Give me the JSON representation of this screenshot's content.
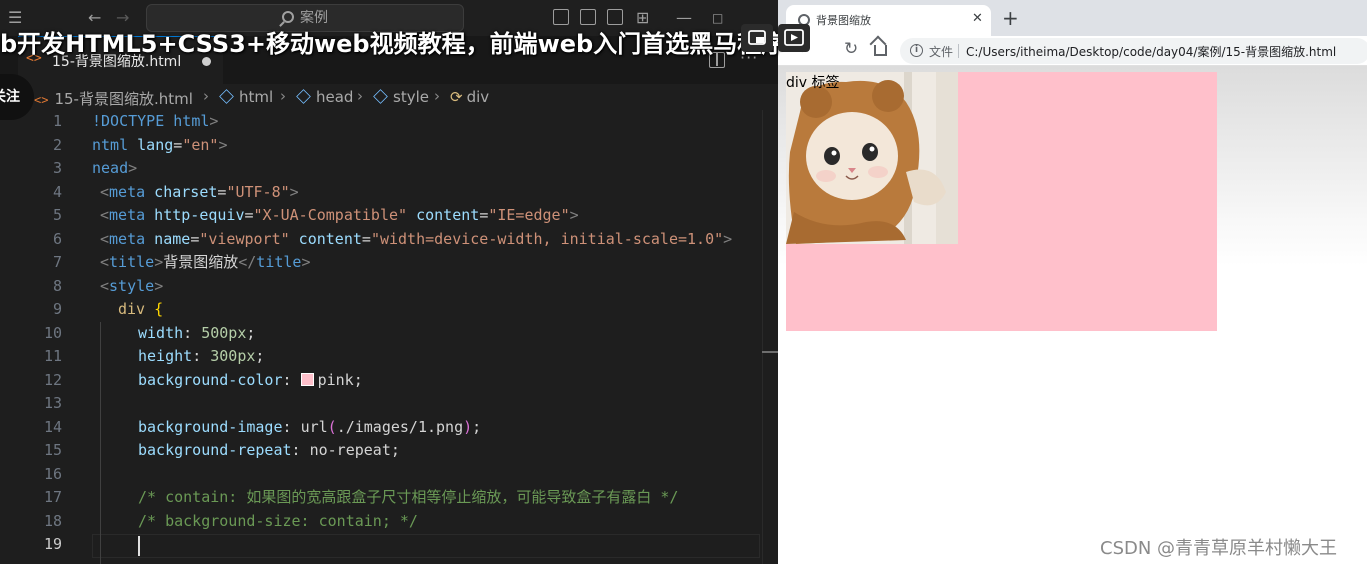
{
  "overlay": {
    "video_title": "b开发HTML5+CSS3+移动web视频教程，前端web入门首选黑马程序",
    "follow_label": "关注"
  },
  "vscode": {
    "search_placeholder": "案例",
    "tab": {
      "label": "15-背景图缩放.html",
      "icon_text": "<>"
    },
    "breadcrumb": [
      {
        "label": "15-背景图缩放.html"
      },
      {
        "label": "html"
      },
      {
        "label": "head"
      },
      {
        "label": "style"
      },
      {
        "label": "div"
      }
    ],
    "active_line": 19,
    "line_numbers": [
      "1",
      "2",
      "3",
      "4",
      "5",
      "6",
      "7",
      "8",
      "9",
      "10",
      "11",
      "12",
      "13",
      "14",
      "15",
      "16",
      "17",
      "18",
      "19"
    ],
    "code": {
      "l1_a": "!DOCTYPE",
      "l1_b": " html",
      "l1_c": ">",
      "l2_a": "ntml",
      "l2_b": " lang",
      "l2_c": "=",
      "l2_d": "\"en\"",
      "l2_e": ">",
      "l3_a": "nead",
      "l3_b": ">",
      "l4_a": "<",
      "l4_b": "meta",
      "l4_c": " charset",
      "l4_d": "=",
      "l4_e": "\"UTF-8\"",
      "l4_f": ">",
      "l5_a": "<",
      "l5_b": "meta",
      "l5_c": " http-equiv",
      "l5_d": "=",
      "l5_e": "\"X-UA-Compatible\"",
      "l5_f": " content",
      "l5_g": "=",
      "l5_h": "\"IE=edge\"",
      "l5_i": ">",
      "l6_a": "<",
      "l6_b": "meta",
      "l6_c": " name",
      "l6_d": "=",
      "l6_e": "\"viewport\"",
      "l6_f": " content",
      "l6_g": "=",
      "l6_h": "\"width=device-width, initial-scale=1.0\"",
      "l6_i": ">",
      "l7_a": "<",
      "l7_b": "title",
      "l7_c": ">",
      "l7_d": "背景图缩放",
      "l7_e": "</",
      "l7_f": "title",
      "l7_g": ">",
      "l8_a": "<",
      "l8_b": "style",
      "l8_c": ">",
      "l9_a": "div",
      "l9_b": " {",
      "l10_a": "width",
      "l10_b": ": ",
      "l10_c": "500px",
      "l10_d": ";",
      "l11_a": "height",
      "l11_b": ": ",
      "l11_c": "300px",
      "l11_d": ";",
      "l12_a": "background-color",
      "l12_b": ": ",
      "l12_c": "pink",
      "l12_d": ";",
      "l14_a": "background-image",
      "l14_b": ": ",
      "l14_c": "url",
      "l14_d": "(",
      "l14_e": "./images/1.png",
      "l14_f": ")",
      "l14_g": ";",
      "l15_a": "background-repeat",
      "l15_b": ": ",
      "l15_c": "no-repeat",
      "l15_d": ";",
      "l17": "/* contain: 如果图的宽高跟盒子尺寸相等停止缩放，可能导致盒子有露白 */",
      "l18": "/* background-size: contain; */"
    }
  },
  "browser": {
    "tab_title": "背景图缩放",
    "file_label": "文件",
    "url": "C:/Users/itheima/Desktop/code/day04/案例/15-背景图缩放.html",
    "page_text": "div 标签",
    "background_color": "#ffc0cb"
  },
  "watermark": "CSDN @青青草原羊村懒大王",
  "colors": {
    "editor_bg": "#1e1e1e",
    "accent": "#0078d4"
  }
}
